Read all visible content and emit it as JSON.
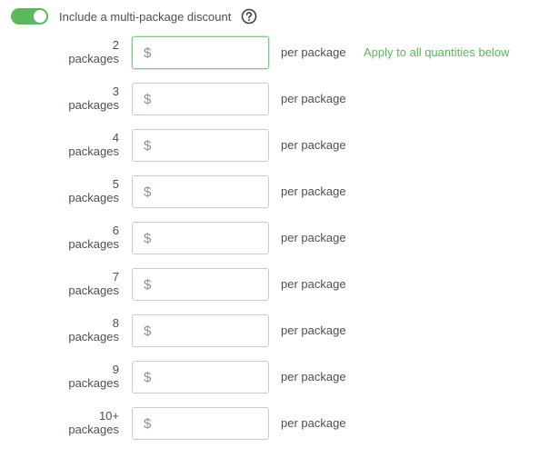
{
  "discount_toggle": {
    "enabled": true,
    "label": "Include a multi-package discount",
    "help_icon": "question-circle-icon",
    "accent_color": "#5cb85c"
  },
  "currency_symbol": "$",
  "per_package_label": "per package",
  "apply_all_link": "Apply to all quantities below",
  "tiers": [
    {
      "quantity": "2",
      "unit": "packages",
      "value": "",
      "focused": true
    },
    {
      "quantity": "3",
      "unit": "packages",
      "value": ""
    },
    {
      "quantity": "4",
      "unit": "packages",
      "value": ""
    },
    {
      "quantity": "5",
      "unit": "packages",
      "value": ""
    },
    {
      "quantity": "6",
      "unit": "packages",
      "value": ""
    },
    {
      "quantity": "7",
      "unit": "packages",
      "value": ""
    },
    {
      "quantity": "8",
      "unit": "packages",
      "value": ""
    },
    {
      "quantity": "9",
      "unit": "packages",
      "value": ""
    },
    {
      "quantity": "10+",
      "unit": "packages",
      "value": ""
    }
  ]
}
